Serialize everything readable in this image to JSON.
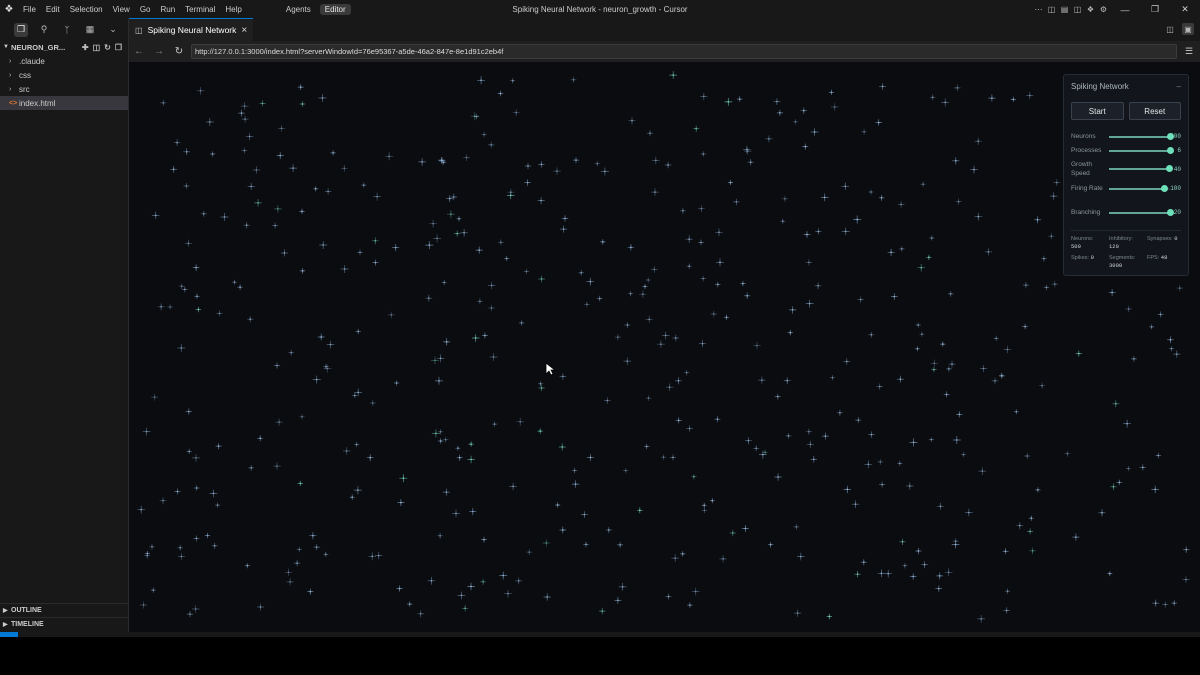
{
  "titlebar": {
    "menus": [
      "File",
      "Edit",
      "Selection",
      "View",
      "Go",
      "Run",
      "Terminal",
      "Help"
    ],
    "agents_label": "Agents",
    "editor_label": "Editor",
    "window_title": "Spiking Neural Network - neuron_growth - Cursor"
  },
  "sidebar": {
    "explorer_title": "NEURON_GR...",
    "tree": [
      {
        "label": ".claude",
        "type": "folder"
      },
      {
        "label": "css",
        "type": "folder"
      },
      {
        "label": "src",
        "type": "folder"
      },
      {
        "label": "index.html",
        "type": "file",
        "selected": true
      }
    ],
    "outline_label": "OUTLINE",
    "timeline_label": "TIMELINE"
  },
  "tab": {
    "title": "Spiking Neural Network"
  },
  "browser": {
    "url": "http://127.0.0.1:3000/index.html?serverWindowId=76e95367-a5de-46a2-847e-8e1d91c2eb4f"
  },
  "panel": {
    "title": "Spiking Network",
    "start_label": "Start",
    "reset_label": "Reset",
    "sliders": [
      {
        "label": "Neurons",
        "value": "500",
        "fraction": 1.0
      },
      {
        "label": "Processes",
        "value": "6",
        "fraction": 1.0
      },
      {
        "label": "Growth Speed",
        "value": "40",
        "fraction": 0.98
      },
      {
        "label": "Firing Rate",
        "value": "100",
        "fraction": 0.9
      },
      {
        "label": "Branching",
        "value": "20",
        "fraction": 1.0
      }
    ],
    "stats": [
      {
        "label": "Neurons:",
        "value": "500"
      },
      {
        "label": "Inhibitory:",
        "value": "120"
      },
      {
        "label": "Synapses:",
        "value": "0"
      },
      {
        "label": "Spikes:",
        "value": "0"
      },
      {
        "label": "Segments:",
        "value": "3000"
      },
      {
        "label": "FPS:",
        "value": "48"
      }
    ]
  },
  "colors": {
    "accent": "#0078d4",
    "slider_thumb": "#6ee0b9",
    "neuron": "#6f8fb0",
    "canvas_bg": "#0a0c10"
  }
}
